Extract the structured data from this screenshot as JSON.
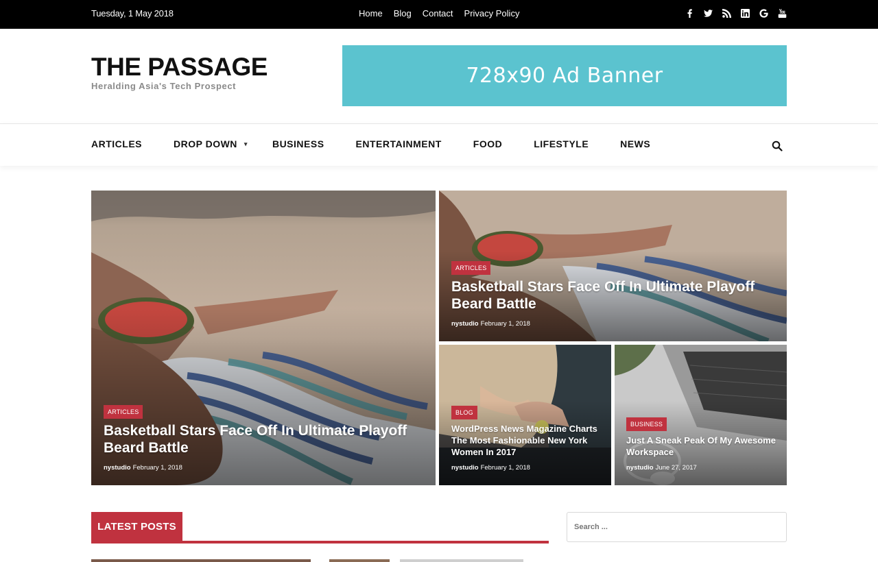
{
  "topbar": {
    "date": "Tuesday, 1 May 2018",
    "nav": [
      "Home",
      "Blog",
      "Contact",
      "Privacy Policy"
    ],
    "social_icons": [
      "facebook-icon",
      "twitter-icon",
      "rss-icon",
      "linkedin-icon",
      "google-icon",
      "youtube-icon"
    ]
  },
  "header": {
    "logo": "THE PASSAGE",
    "tagline": "Heralding Asia's Tech Prospect",
    "ad_banner": "728x90 Ad Banner"
  },
  "menu": {
    "items": [
      "ARTICLES",
      "DROP DOWN",
      "BUSINESS",
      "ENTERTAINMENT",
      "FOOD",
      "LIFESTYLE",
      "NEWS"
    ]
  },
  "featured": [
    {
      "category": "ARTICLES",
      "title": "Basketball Stars Face Off In Ultimate Playoff Beard Battle",
      "author": "nystudio",
      "date": "February 1, 2018"
    },
    {
      "category": "ARTICLES",
      "title": "Basketball Stars Face Off In Ultimate Playoff Beard Battle",
      "author": "nystudio",
      "date": "February 1, 2018"
    },
    {
      "category": "BLOG",
      "title": "WordPress News Magazine Charts The Most Fashionable New York Women In 2017",
      "author": "nystudio",
      "date": "February 1, 2018"
    },
    {
      "category": "BUSINESS",
      "title": "Just A Sneak Peak Of My Awesome Workspace",
      "author": "nystudio",
      "date": "June 27, 2017"
    }
  ],
  "latest": {
    "heading": "LATEST POSTS"
  },
  "sidebar": {
    "search_placeholder": "Search ..."
  },
  "colors": {
    "accent": "#c0323f",
    "ad": "#5bc3cf",
    "topbar": "#000000"
  }
}
